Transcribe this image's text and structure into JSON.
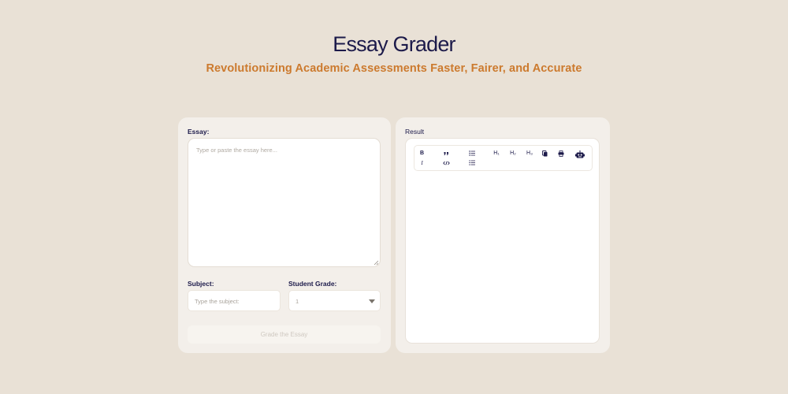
{
  "header": {
    "title": "Essay Grader",
    "subtitle": "Revolutionizing Academic Assessments Faster, Fairer, and Accurate"
  },
  "form": {
    "essay_label": "Essay:",
    "essay_placeholder": "Type or paste the essay here...",
    "subject_label": "Subject:",
    "subject_placeholder": "Type the subject:",
    "grade_label": "Student Grade:",
    "grade_value": "1",
    "submit_label": "Grade the Essay"
  },
  "result": {
    "label": "Result",
    "toolbar": {
      "bold": "B",
      "italic": "I",
      "h1": "H₁",
      "h2": "H₂",
      "h3": "H₃",
      "icons": [
        "bold-icon",
        "quote-icon",
        "unordered-list-icon",
        "italic-icon",
        "code-icon",
        "ordered-list-icon",
        "heading-1-icon",
        "heading-2-icon",
        "heading-3-icon",
        "copy-icon",
        "print-icon",
        "robot-icon"
      ]
    }
  },
  "colors": {
    "background": "#e9e1d6",
    "title": "#1c1a4a",
    "subtitle": "#cc7a2e",
    "panel": "#f3efea"
  }
}
